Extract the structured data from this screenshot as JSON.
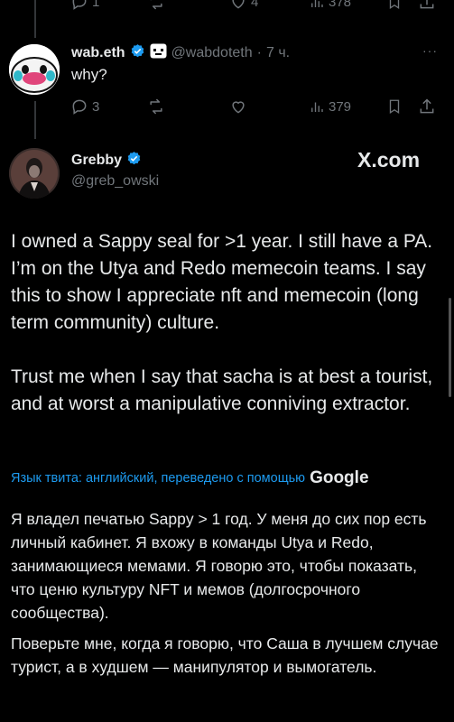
{
  "top_actions": {
    "replies": "1",
    "retweets": "",
    "likes": "4",
    "views": "378"
  },
  "reply_tweet": {
    "display_name": "wab.eth",
    "handle": "@wabdoteth",
    "separator": "·",
    "time": "7 ч.",
    "text": "why?",
    "more": "···",
    "actions": {
      "replies": "3",
      "views": "379"
    }
  },
  "main_tweet": {
    "display_name": "Grebby",
    "handle": "@greb_owski",
    "logo_text": "X.com",
    "paragraphs": [
      "I owned a Sappy seal for >1 year. I still have a PA. I’m on the Utya and Redo memecoin teams. I say this to show I appreciate nft and memecoin (long term community) culture.",
      "Trust me when I say that sacha is at best a tourist, and at worst a manipulative conniving extractor."
    ]
  },
  "translation": {
    "notice": "Язык твита: английский, переведено с помощью",
    "brand": "Google",
    "paragraphs": [
      "Я владел печатью Sappy > 1 год. У меня до сих пор есть личный кабинет. Я вхожу в команды Utya и Redo, занимающиеся мемами. Я говорю это, чтобы показать, что ценю культуру NFT и мемов (долгосрочного сообщества).",
      "Поверьте мне, когда я говорю, что Саша в лучшем случае турист, а в худшем — манипулятор и вымогатель."
    ]
  },
  "colors": {
    "background": "#000000",
    "text": "#e7e9ea",
    "muted": "#71767b",
    "verified": "#1d9bf0",
    "link": "#1d9bf0"
  }
}
